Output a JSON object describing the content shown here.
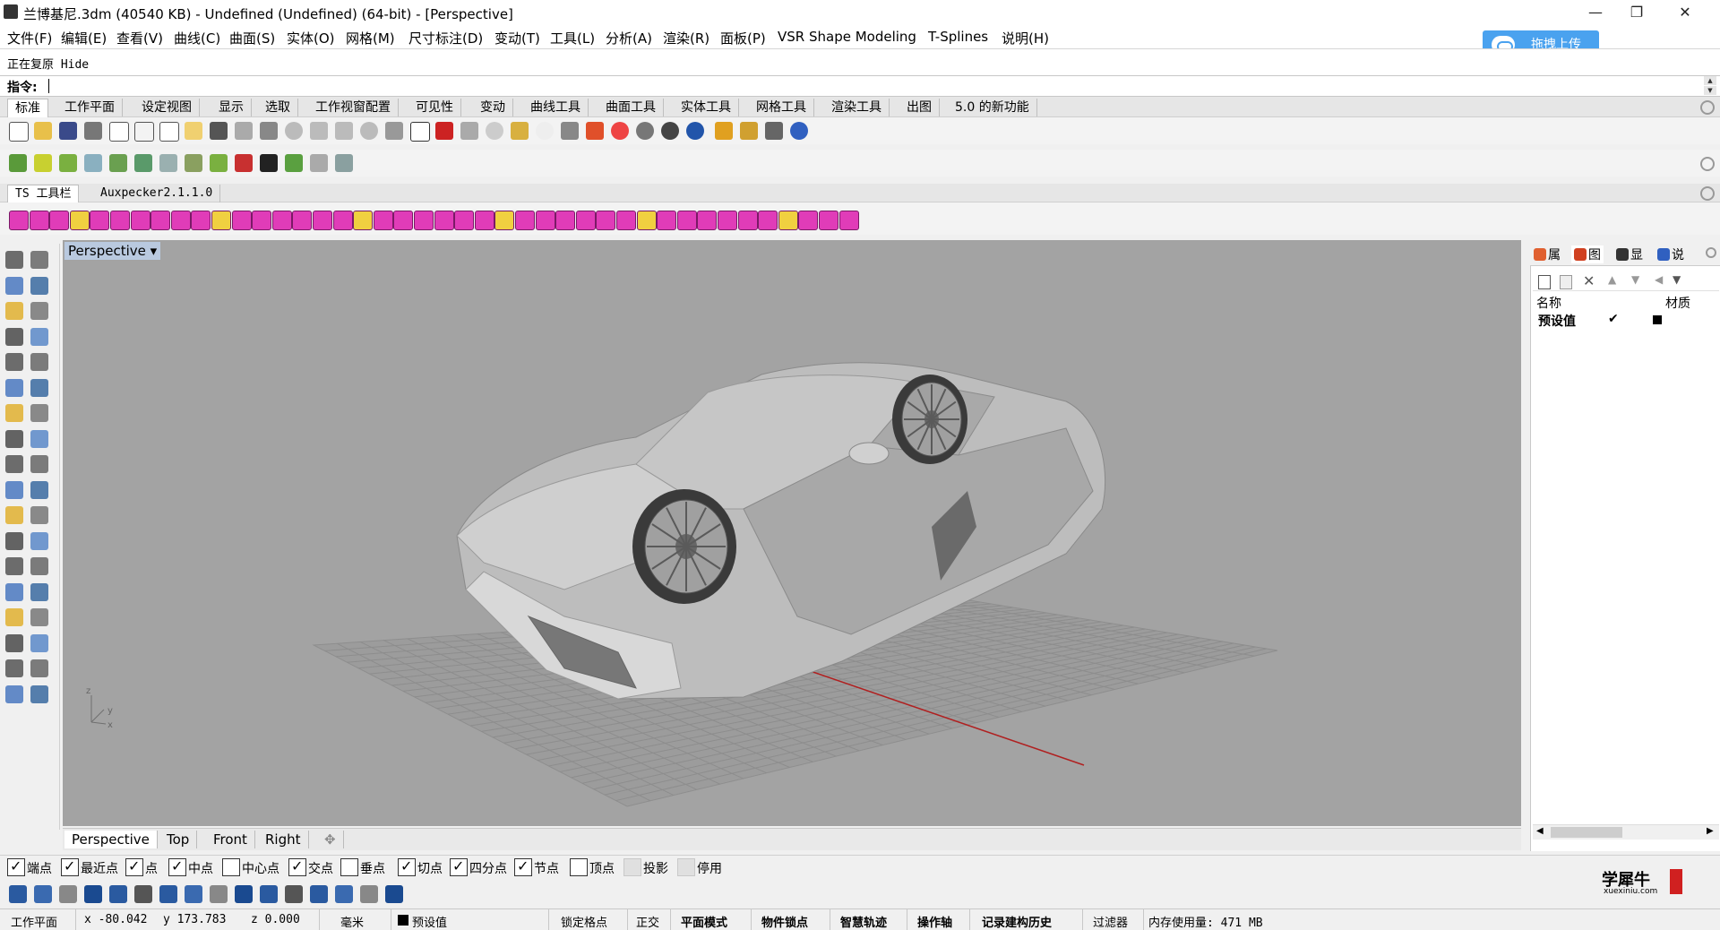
{
  "window": {
    "title": "兰博基尼.3dm (40540 KB) - Undefined (Undefined) (64-bit) - [Perspective]",
    "minimize": "—",
    "restore": "❐",
    "close": "✕"
  },
  "menu": [
    "文件(F)",
    "编辑(E)",
    "查看(V)",
    "曲线(C)",
    "曲面(S)",
    "实体(O)",
    "网格(M)",
    "尺寸标注(D)",
    "变动(T)",
    "工具(L)",
    "分析(A)",
    "渲染(R)",
    "面板(P)",
    "VSR Shape Modeling",
    "T-Splines",
    "说明(H)"
  ],
  "upload_button": "拖拽上传",
  "command": {
    "history": "正在复原 Hide",
    "prompt": "指令:"
  },
  "toolbar_tabs": [
    "标准",
    "工作平面",
    "设定视图",
    "显示",
    "选取",
    "工作视窗配置",
    "可见性",
    "变动",
    "曲线工具",
    "曲面工具",
    "实体工具",
    "网格工具",
    "渲染工具",
    "出图",
    "5.0 的新功能"
  ],
  "ts_tabs": [
    "TS 工具栏",
    "Auxpecker2.1.1.0"
  ],
  "viewport": {
    "label": "Perspective",
    "dropdown": "▾",
    "axis_z": "z",
    "axis_y": "y",
    "axis_x": "x"
  },
  "viewport_tabs": [
    "Perspective",
    "Top",
    "Front",
    "Right",
    "✥"
  ],
  "right_panel": {
    "tabs": [
      "属",
      "图",
      "显",
      "说"
    ],
    "col_name": "名称",
    "col_material": "材质",
    "row_name": "预设值",
    "row_check": "✔"
  },
  "osnap": [
    {
      "label": "端点",
      "checked": true
    },
    {
      "label": "最近点",
      "checked": true
    },
    {
      "label": "点",
      "checked": true
    },
    {
      "label": "中点",
      "checked": true
    },
    {
      "label": "中心点",
      "checked": false
    },
    {
      "label": "交点",
      "checked": true
    },
    {
      "label": "垂点",
      "checked": false
    },
    {
      "label": "切点",
      "checked": true
    },
    {
      "label": "四分点",
      "checked": true
    },
    {
      "label": "节点",
      "checked": true
    },
    {
      "label": "顶点",
      "checked": false
    },
    {
      "label": "投影",
      "checked": false,
      "disabled": true
    },
    {
      "label": "停用",
      "checked": false,
      "disabled": true
    }
  ],
  "status": {
    "cplane": "工作平面",
    "x": "x -80.042",
    "y": "y 173.783",
    "z": "z 0.000",
    "units": "毫米",
    "layer": "预设值",
    "grid_snap": "锁定格点",
    "ortho": "正交",
    "planar": "平面模式",
    "osnap": "物件锁点",
    "smarttrack": "智慧轨迹",
    "gumball": "操作轴",
    "history": "记录建构历史",
    "filter": "过滤器",
    "memory": "内存使用量: 471 MB"
  },
  "watermark": {
    "text": "学犀牛",
    "url": "xuexiniu.com"
  },
  "colors": {
    "viewport_bg": "#a3a3a3",
    "grid": "#8e8e8e",
    "x_axis": "#b02020",
    "upload": "#4aa2ef",
    "ts_icon": "#e03cb8"
  }
}
